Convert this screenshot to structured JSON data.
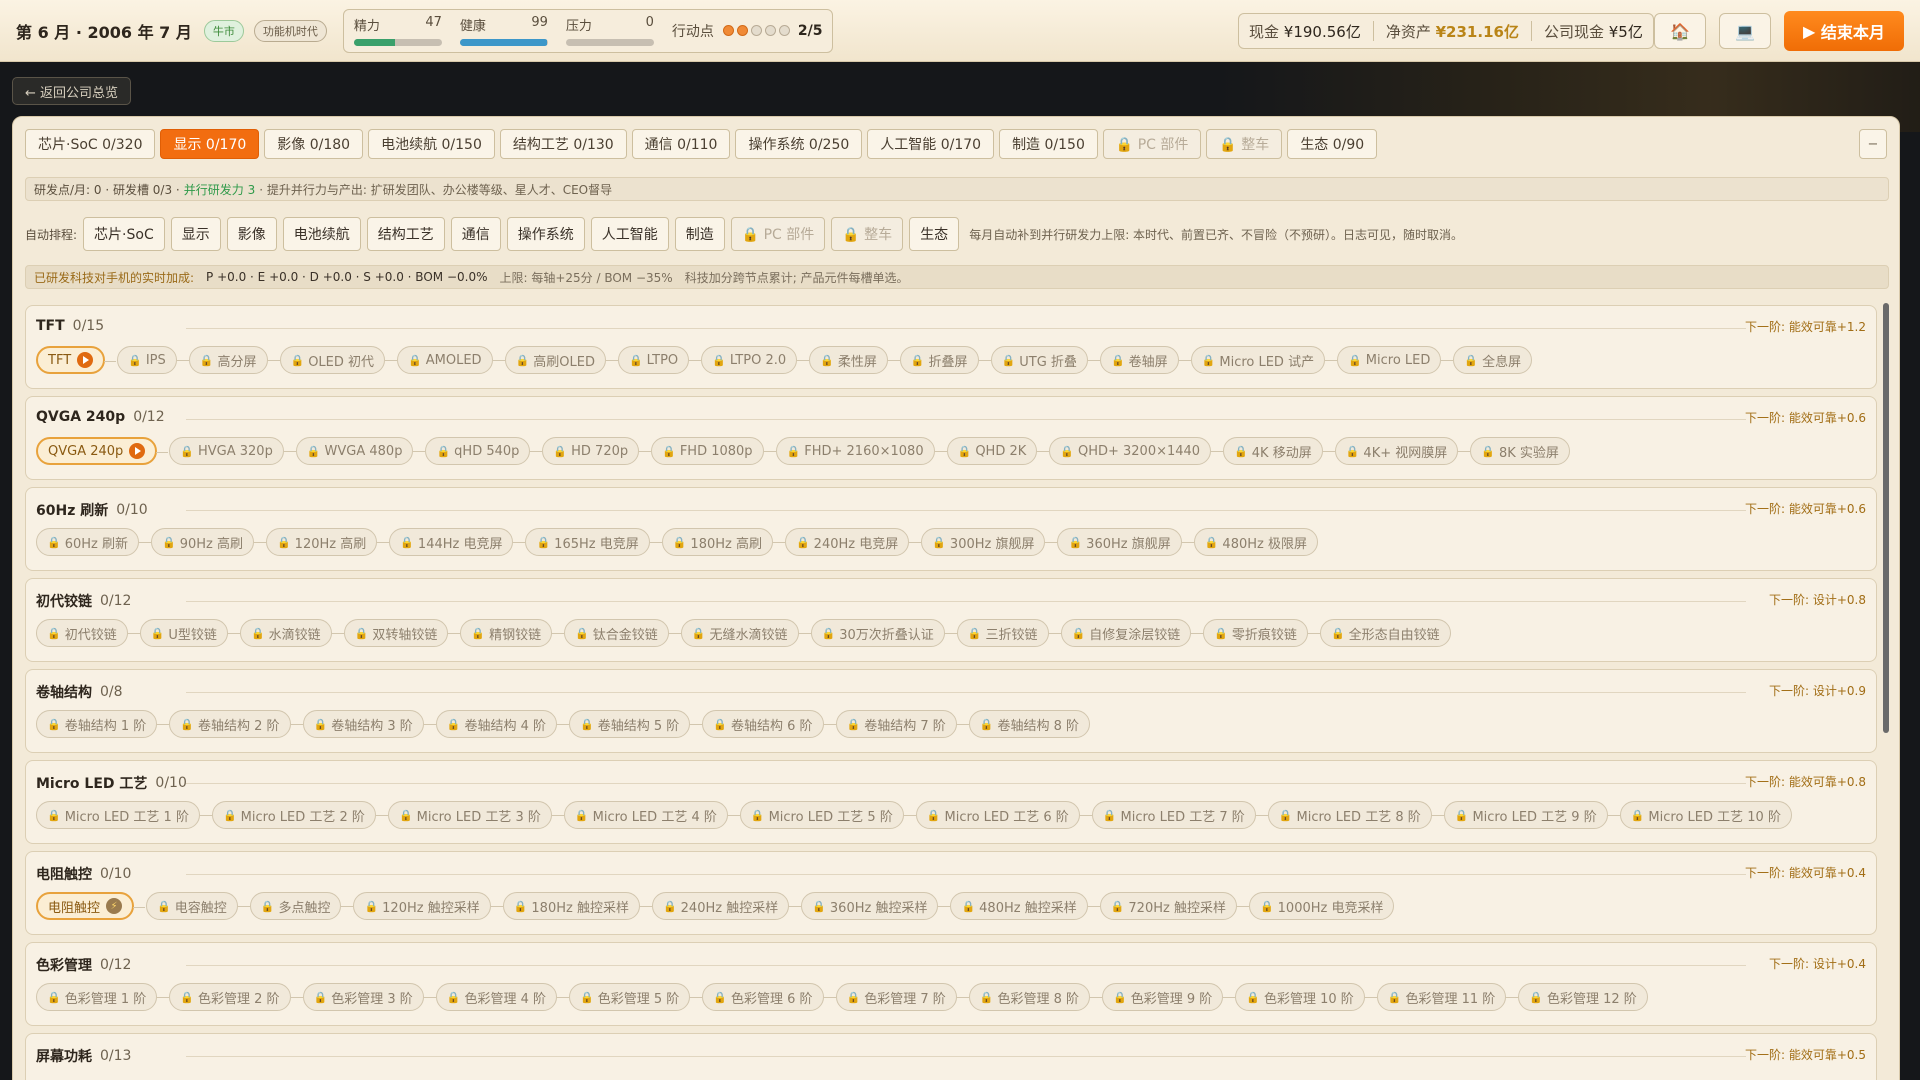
{
  "topbar": {
    "date": "第 6 月 · 2006 年 7 月",
    "market_badge": "牛市",
    "era_badge": "功能机时代",
    "stats": [
      {
        "label": "精力",
        "value": "47",
        "fill": 0.47,
        "color": "#3aa06b"
      },
      {
        "label": "健康",
        "value": "99",
        "fill": 0.99,
        "color": "#3d97c9"
      },
      {
        "label": "压力",
        "value": "0",
        "fill": 0.0,
        "color": "#8a8a8a"
      }
    ],
    "action_points": {
      "label": "行动点",
      "used": 2,
      "total": 5,
      "text": "2/5"
    },
    "cash_label": "现金",
    "cash_value": "¥190.56亿",
    "net_label": "净资产",
    "net_value": "¥231.16亿",
    "company_cash_label": "公司现金",
    "company_cash_value": "¥5亿",
    "home_icon": "house-icon",
    "device_icon": "laptop-icon",
    "end_turn": "结束本月"
  },
  "back_button": "← 返回公司总览",
  "tabs": [
    {
      "label": "芯片·SoC 0/320",
      "state": "normal"
    },
    {
      "label": "显示 0/170",
      "state": "active"
    },
    {
      "label": "影像 0/180",
      "state": "normal"
    },
    {
      "label": "电池续航 0/150",
      "state": "normal"
    },
    {
      "label": "结构工艺 0/130",
      "state": "normal"
    },
    {
      "label": "通信 0/110",
      "state": "normal"
    },
    {
      "label": "操作系统 0/250",
      "state": "normal"
    },
    {
      "label": "人工智能 0/170",
      "state": "normal"
    },
    {
      "label": "制造 0/150",
      "state": "normal"
    },
    {
      "label": "🔒 PC 部件",
      "state": "locked"
    },
    {
      "label": "🔒 整车",
      "state": "locked"
    },
    {
      "label": "生态 0/90",
      "state": "normal"
    }
  ],
  "collapse_label": "−",
  "research_info": {
    "a": "研发点/月: 0 · 研发槽 0/3 ·",
    "b": "并行研发力 3",
    "c": "· 提升并行力与产出: 扩研发团队、办公楼等级、星人才、CEO督导"
  },
  "auto_queue": {
    "label": "自动排程:",
    "items": [
      {
        "label": "芯片·SoC",
        "locked": false
      },
      {
        "label": "显示",
        "locked": false
      },
      {
        "label": "影像",
        "locked": false
      },
      {
        "label": "电池续航",
        "locked": false
      },
      {
        "label": "结构工艺",
        "locked": false
      },
      {
        "label": "通信",
        "locked": false
      },
      {
        "label": "操作系统",
        "locked": false
      },
      {
        "label": "人工智能",
        "locked": false
      },
      {
        "label": "制造",
        "locked": false
      },
      {
        "label": "🔒 PC 部件",
        "locked": true
      },
      {
        "label": "🔒 整车",
        "locked": true
      },
      {
        "label": "生态",
        "locked": false
      }
    ],
    "note": "每月自动补到并行研发力上限: 本时代、前置已齐、不冒险（不预研）。日志可见，随时取消。"
  },
  "bonus_info": {
    "label": "已研发科技对手机的实时加成:",
    "values": "P +0.0 · E +0.0 · D +0.0 · S +0.0 · BOM −0.0%",
    "limits": "上限: 每轴+25分 / BOM −35%",
    "hint": "科技加分跨节点累计; 产品元件每槽单选。"
  },
  "tracks": [
    {
      "name": "TFT",
      "progress": "0/15",
      "next": "下一阶: 能效可靠+1.2",
      "current": {
        "label": "TFT",
        "mark": "play"
      },
      "nodes": [
        "IPS",
        "高分屏",
        "OLED 初代",
        "AMOLED",
        "高刷OLED",
        "LTPO",
        "LTPO 2.0",
        "柔性屏",
        "折叠屏",
        "UTG 折叠",
        "卷轴屏",
        "Micro LED 试产",
        "Micro LED",
        "全息屏"
      ]
    },
    {
      "name": "QVGA 240p",
      "progress": "0/12",
      "next": "下一阶: 能效可靠+0.6",
      "current": {
        "label": "QVGA 240p",
        "mark": "play"
      },
      "nodes": [
        "HVGA 320p",
        "WVGA 480p",
        "qHD 540p",
        "HD 720p",
        "FHD 1080p",
        "FHD+ 2160×1080",
        "QHD 2K",
        "QHD+ 3200×1440",
        "4K 移动屏",
        "4K+ 视网膜屏",
        "8K 实验屏"
      ]
    },
    {
      "name": "60Hz 刷新",
      "progress": "0/10",
      "next": "下一阶: 能效可靠+0.6",
      "current": null,
      "nodes": [
        "60Hz 刷新",
        "90Hz 高刷",
        "120Hz 高刷",
        "144Hz 电竞屏",
        "165Hz 电竞屏",
        "180Hz 高刷",
        "240Hz 电竞屏",
        "300Hz 旗舰屏",
        "360Hz 旗舰屏",
        "480Hz 极限屏"
      ]
    },
    {
      "name": "初代铰链",
      "progress": "0/12",
      "next": "下一阶: 设计+0.8",
      "current": null,
      "nodes": [
        "初代铰链",
        "U型铰链",
        "水滴铰链",
        "双转轴铰链",
        "精钢铰链",
        "钛合金铰链",
        "无缝水滴铰链",
        "30万次折叠认证",
        "三折铰链",
        "自修复涂层铰链",
        "零折痕铰链",
        "全形态自由铰链"
      ]
    },
    {
      "name": "卷轴结构",
      "progress": "0/8",
      "next": "下一阶: 设计+0.9",
      "current": null,
      "nodes": [
        "卷轴结构 1 阶",
        "卷轴结构 2 阶",
        "卷轴结构 3 阶",
        "卷轴结构 4 阶",
        "卷轴结构 5 阶",
        "卷轴结构 6 阶",
        "卷轴结构 7 阶",
        "卷轴结构 8 阶"
      ]
    },
    {
      "name": "Micro LED 工艺",
      "progress": "0/10",
      "next": "下一阶: 能效可靠+0.8",
      "current": null,
      "nodes": [
        "Micro LED 工艺 1 阶",
        "Micro LED 工艺 2 阶",
        "Micro LED 工艺 3 阶",
        "Micro LED 工艺 4 阶",
        "Micro LED 工艺 5 阶",
        "Micro LED 工艺 6 阶",
        "Micro LED 工艺 7 阶",
        "Micro LED 工艺 8 阶",
        "Micro LED 工艺 9 阶",
        "Micro LED 工艺 10 阶"
      ]
    },
    {
      "name": "电阻触控",
      "progress": "0/10",
      "next": "下一阶: 能效可靠+0.4",
      "current": {
        "label": "电阻触控",
        "mark": "bolt"
      },
      "nodes": [
        "电容触控",
        "多点触控",
        "120Hz 触控采样",
        "180Hz 触控采样",
        "240Hz 触控采样",
        "360Hz 触控采样",
        "480Hz 触控采样",
        "720Hz 触控采样",
        "1000Hz 电竞采样"
      ]
    },
    {
      "name": "色彩管理",
      "progress": "0/12",
      "next": "下一阶: 设计+0.4",
      "current": null,
      "nodes": [
        "色彩管理 1 阶",
        "色彩管理 2 阶",
        "色彩管理 3 阶",
        "色彩管理 4 阶",
        "色彩管理 5 阶",
        "色彩管理 6 阶",
        "色彩管理 7 阶",
        "色彩管理 8 阶",
        "色彩管理 9 阶",
        "色彩管理 10 阶",
        "色彩管理 11 阶",
        "色彩管理 12 阶"
      ]
    },
    {
      "name": "屏幕功耗",
      "progress": "0/13",
      "next": "下一阶: 能效可靠+0.5",
      "current": null,
      "nodes": []
    }
  ]
}
